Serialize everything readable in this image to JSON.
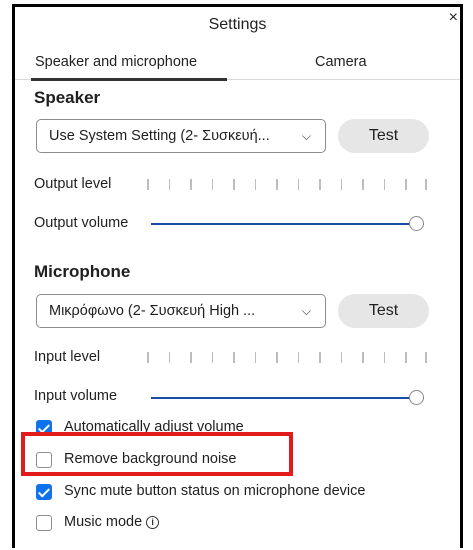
{
  "window": {
    "title": "Settings",
    "close_glyph": "×"
  },
  "tabs": [
    {
      "label": "Speaker and microphone",
      "active": true
    },
    {
      "label": "Camera",
      "active": false
    }
  ],
  "speaker": {
    "section_title": "Speaker",
    "device": "Use System Setting (2- Συσκευή...",
    "test_label": "Test",
    "output_level_label": "Output level",
    "output_volume_label": "Output volume",
    "output_volume_value": 1.0
  },
  "microphone": {
    "section_title": "Microphone",
    "device": "Μικρόφωνο (2- Συσκευή High ...",
    "test_label": "Test",
    "input_level_label": "Input level",
    "input_volume_label": "Input volume",
    "input_volume_value": 1.0
  },
  "options": {
    "auto_adjust": {
      "label": "Automatically adjust volume",
      "checked": true
    },
    "remove_noise": {
      "label": "Remove background noise",
      "checked": false
    },
    "sync_mute": {
      "label": "Sync mute button status on microphone device",
      "checked": true
    },
    "music_mode": {
      "label": "Music mode",
      "checked": false
    }
  },
  "icons": {
    "dropdown": "chevron-down-icon",
    "info": "info-icon",
    "close": "close-icon"
  },
  "colors": {
    "accent": "#0e72ed",
    "slider_track": "#1b4ca6",
    "highlight": "#e41b1b"
  }
}
